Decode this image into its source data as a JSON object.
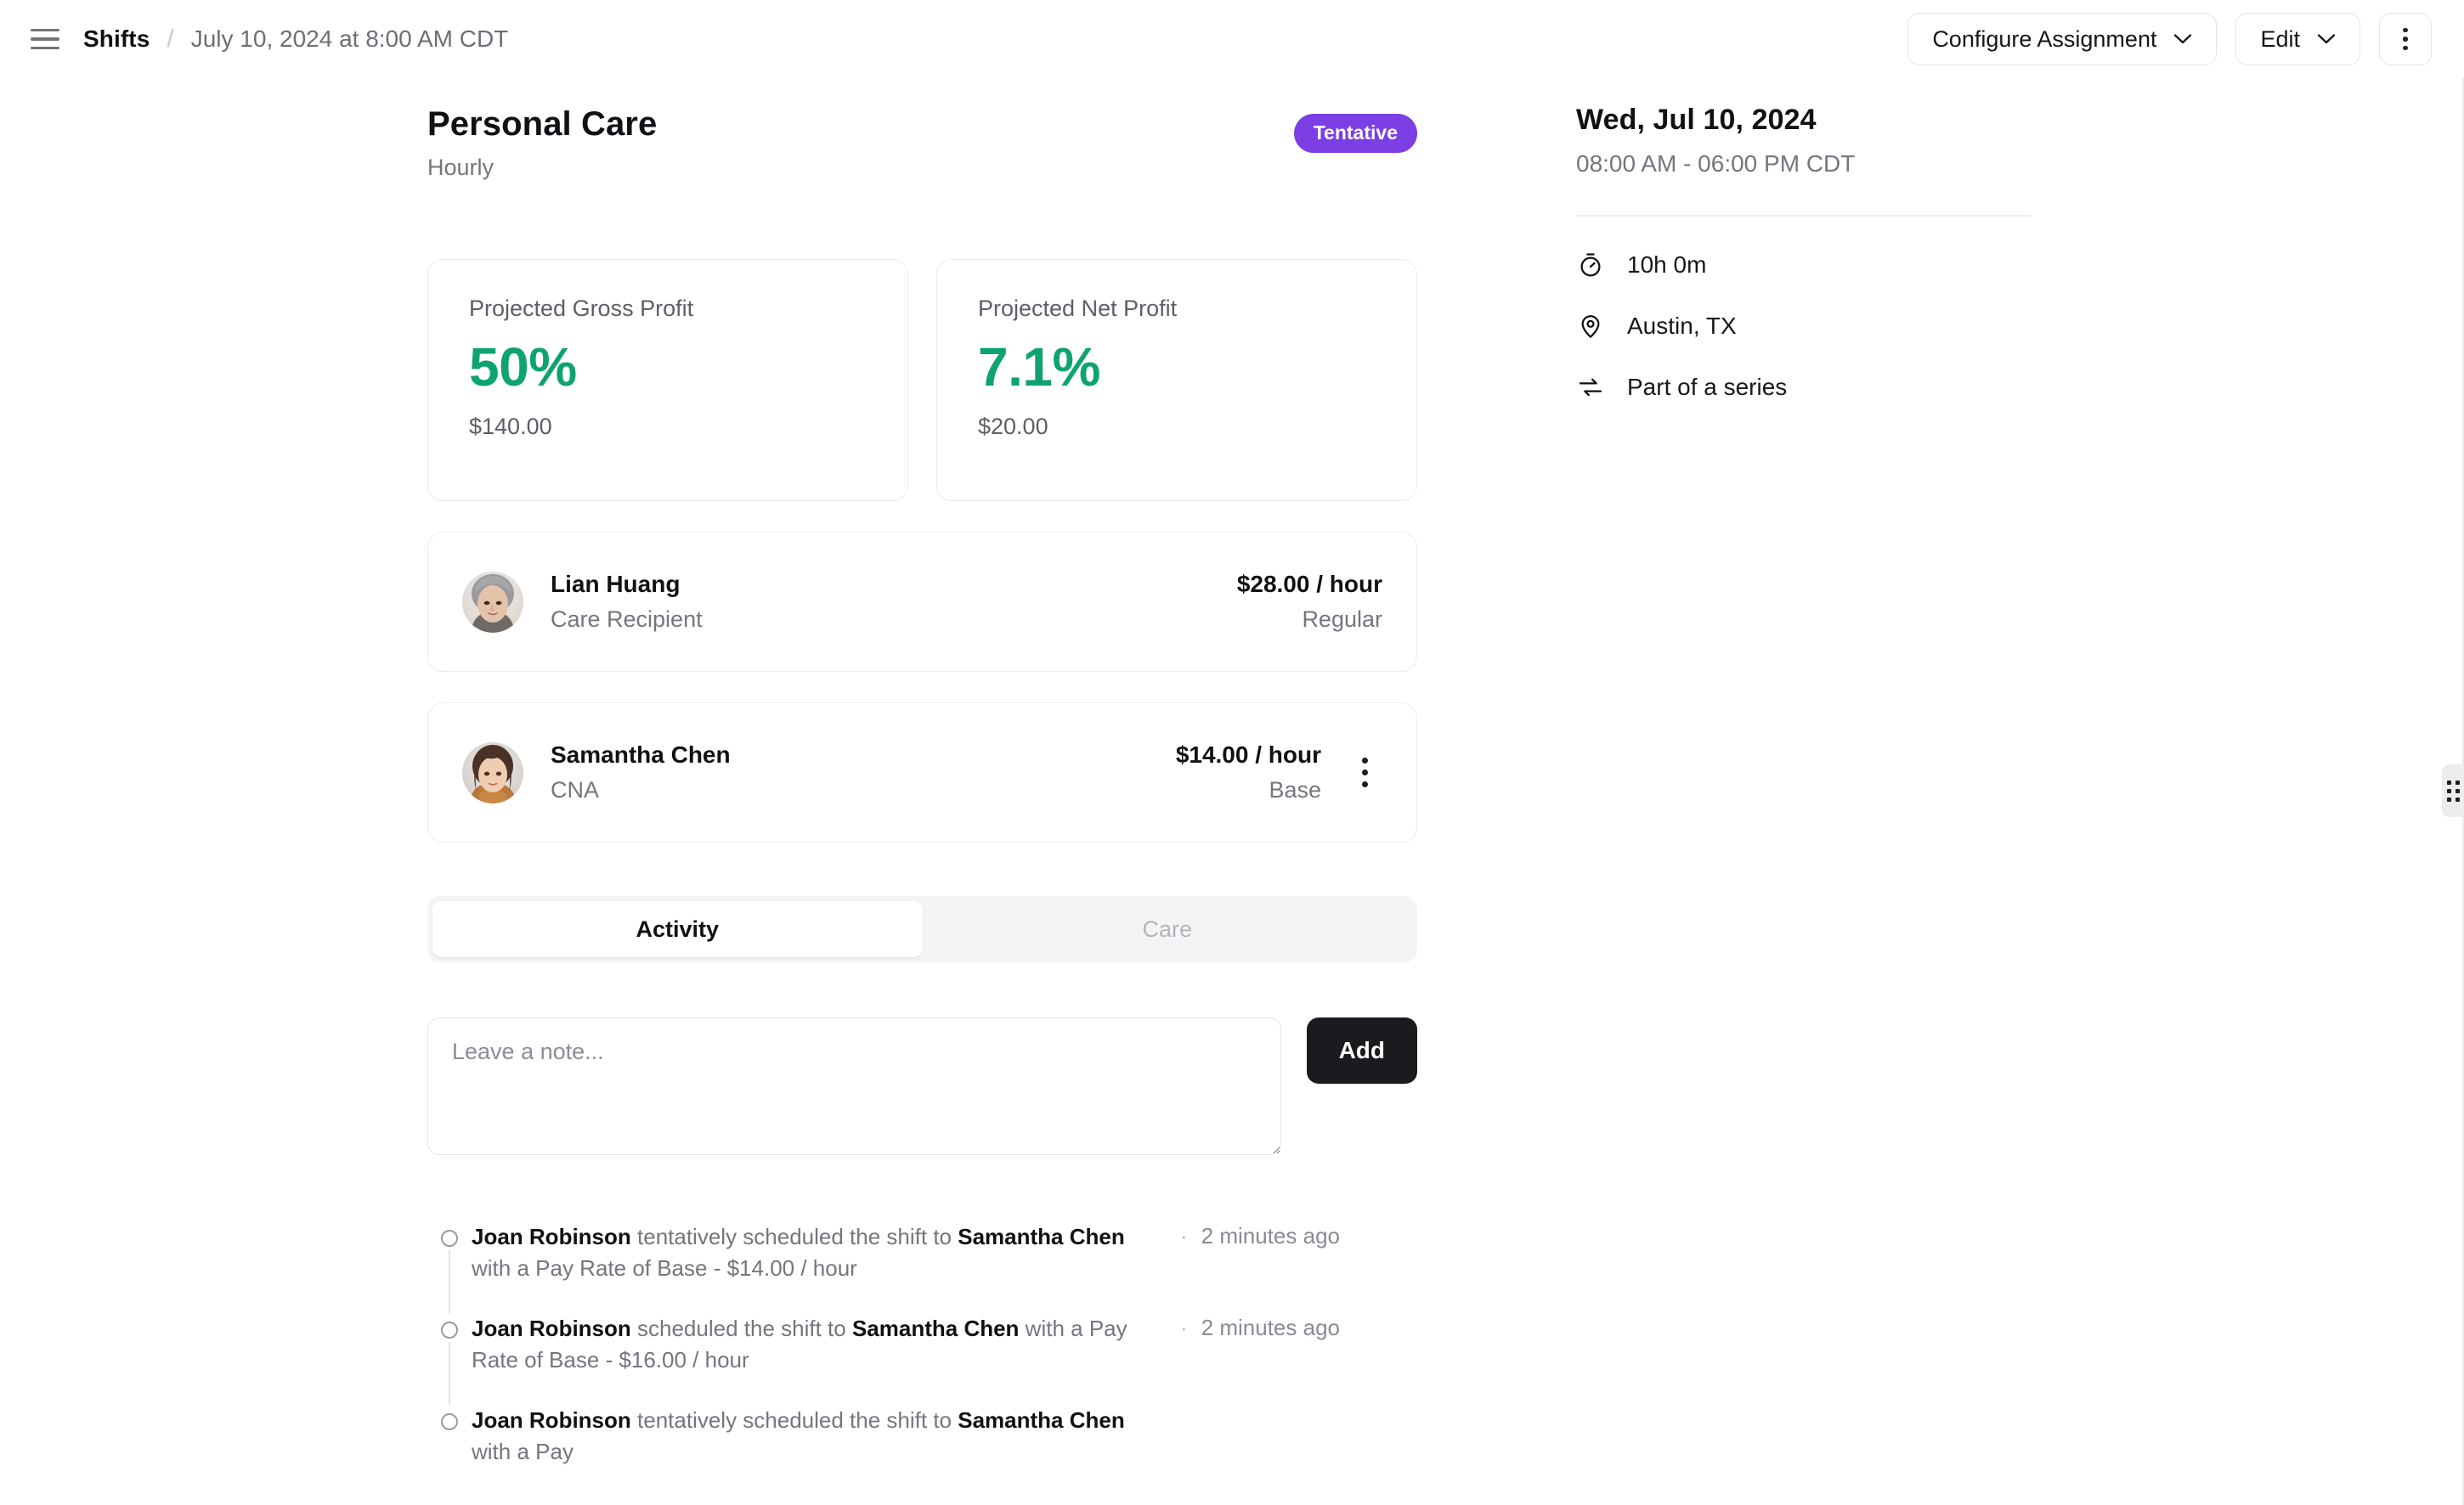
{
  "topbar": {
    "menu_icon": "hamburger-icon",
    "breadcrumb_root": "Shifts",
    "breadcrumb_separator": "/",
    "breadcrumb_current": "July 10, 2024 at 8:00 AM CDT",
    "configure_assignment_label": "Configure Assignment",
    "edit_label": "Edit",
    "more_icon": "kebab-menu-icon"
  },
  "shift": {
    "title": "Personal Care",
    "subtitle": "Hourly",
    "status_badge": "Tentative",
    "status_color": "#7b3fe4"
  },
  "metrics": [
    {
      "label": "Projected Gross Profit",
      "value": "50%",
      "amount": "$140.00",
      "color": "#0ea371"
    },
    {
      "label": "Projected Net Profit",
      "value": "7.1%",
      "amount": "$20.00",
      "color": "#0ea371"
    }
  ],
  "people": [
    {
      "name": "Lian Huang",
      "role": "Care Recipient",
      "pay_rate": "$28.00 / hour",
      "pay_type": "Regular",
      "avatar": "avatar-lian-huang",
      "has_menu": false
    },
    {
      "name": "Samantha Chen",
      "role": "CNA",
      "pay_rate": "$14.00 / hour",
      "pay_type": "Base",
      "avatar": "avatar-samantha-chen",
      "has_menu": true
    }
  ],
  "tabs": [
    {
      "label": "Activity",
      "active": true
    },
    {
      "label": "Care",
      "active": false
    }
  ],
  "composer": {
    "note_value": "",
    "note_placeholder": "Leave a note...",
    "add_label": "Add"
  },
  "activity": [
    {
      "actor": "Joan Robinson",
      "text_1": " tentatively scheduled the shift to ",
      "subject": "Samantha Chen",
      "text_2": " with a Pay Rate of Base - $14.00 / hour",
      "separator": "·",
      "time": "2 minutes ago"
    },
    {
      "actor": "Joan Robinson",
      "text_1": " scheduled the shift to ",
      "subject": "Samantha Chen",
      "text_2": " with a Pay Rate of Base - $16.00 / hour",
      "separator": "·",
      "time": "2 minutes ago"
    },
    {
      "actor": "Joan Robinson",
      "text_1": " tentatively scheduled the shift to ",
      "subject": "Samantha Chen",
      "text_2": " with a Pay",
      "separator": "·",
      "time": ""
    }
  ],
  "details": {
    "date": "Wed, Jul 10, 2024",
    "time_range": "08:00 AM - 06:00 PM CDT",
    "rows": [
      {
        "icon": "stopwatch-icon",
        "label": "10h 0m"
      },
      {
        "icon": "location-pin-icon",
        "label": "Austin, TX"
      },
      {
        "icon": "repeat-series-icon",
        "label": "Part of a series"
      }
    ]
  }
}
